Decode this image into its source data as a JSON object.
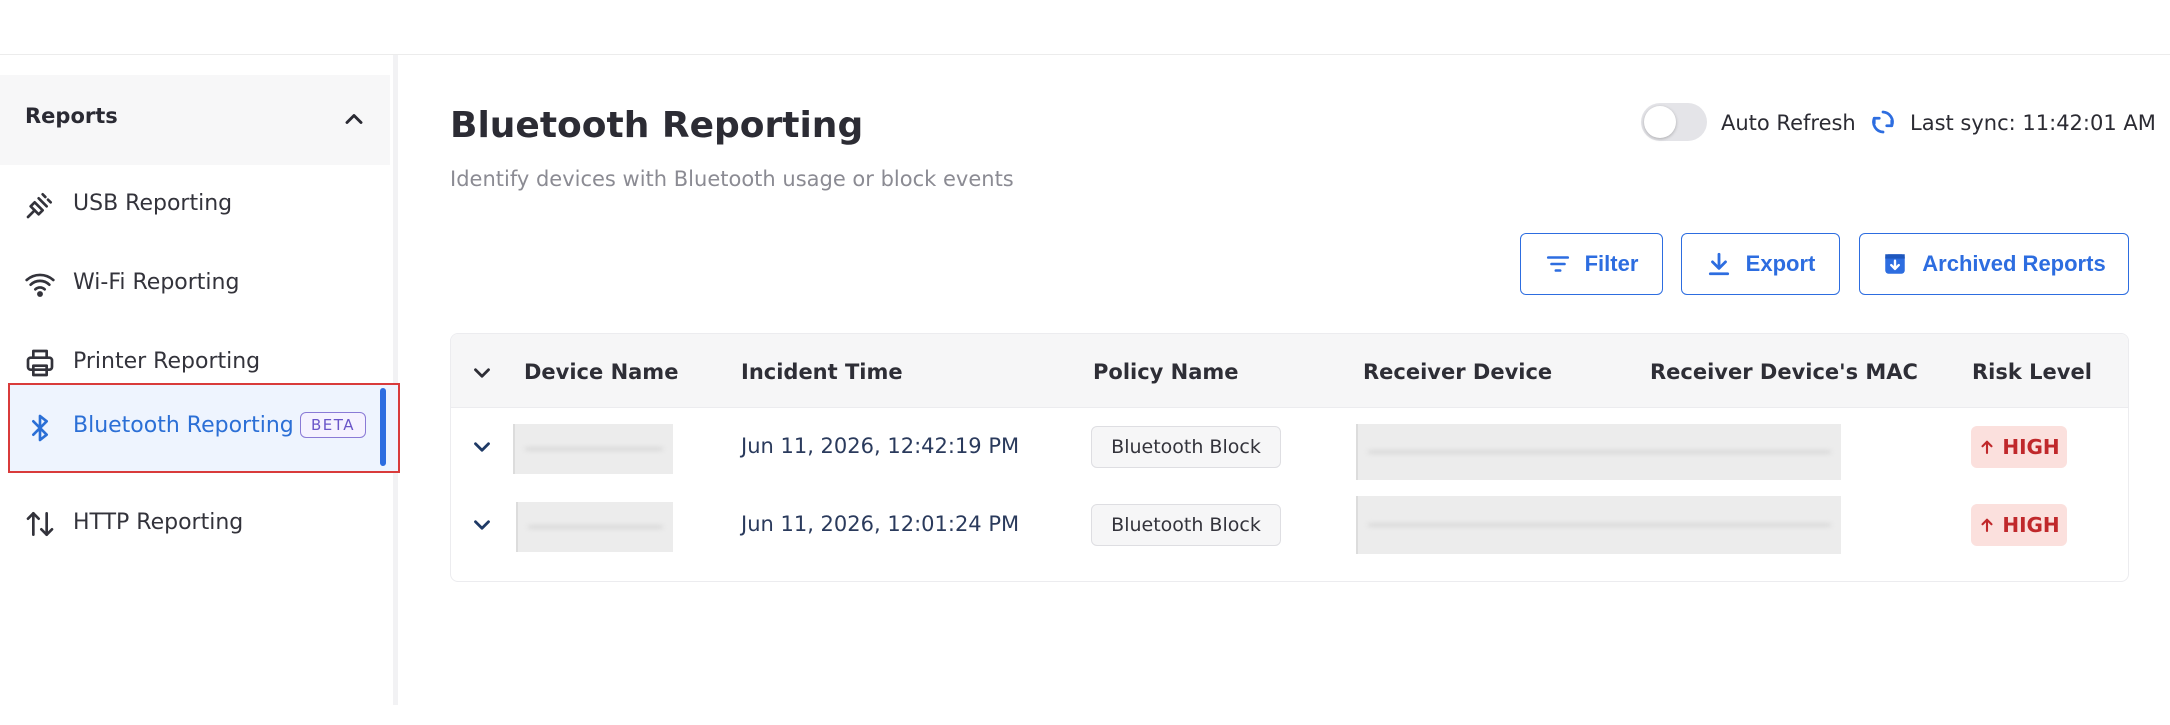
{
  "sidebar": {
    "section_label": "Reports",
    "items": [
      {
        "label": "USB Reporting",
        "icon": "usb-plug-icon"
      },
      {
        "label": "Wi-Fi Reporting",
        "icon": "wifi-icon"
      },
      {
        "label": "Printer Reporting",
        "icon": "printer-icon"
      },
      {
        "label": "Bluetooth Reporting",
        "icon": "bluetooth-icon",
        "badge": "BETA",
        "active": true
      },
      {
        "label": "HTTP Reporting",
        "icon": "arrows-up-down-icon"
      }
    ]
  },
  "header": {
    "title": "Bluetooth Reporting",
    "subtitle": "Identify devices with Bluetooth usage or block events",
    "auto_refresh_label": "Auto Refresh",
    "auto_refresh_on": false,
    "last_sync": "Last sync: 11:42:01 AM"
  },
  "toolbar": {
    "filter_label": "Filter",
    "export_label": "Export",
    "archived_label": "Archived Reports"
  },
  "table": {
    "columns": [
      "Device Name",
      "Incident Time",
      "Policy Name",
      "Receiver Device",
      "Receiver Device's MAC",
      "Risk Level"
    ],
    "rows": [
      {
        "device_name": "",
        "incident_time": "Jun 11, 2026, 12:42:19 PM",
        "policy_name": "Bluetooth Block",
        "receiver_device": "",
        "receiver_mac": "",
        "risk_level": "HIGH"
      },
      {
        "device_name": "",
        "incident_time": "Jun 11, 2026, 12:01:24 PM",
        "policy_name": "Bluetooth Block",
        "receiver_device": "",
        "receiver_mac": "",
        "risk_level": "HIGH"
      }
    ]
  },
  "colors": {
    "accent": "#2d6de0",
    "active_bg": "#eef4fe",
    "risk_high_bg": "#fbe0dd",
    "risk_high_text": "#c0282b",
    "beta": "#6a55c8"
  }
}
